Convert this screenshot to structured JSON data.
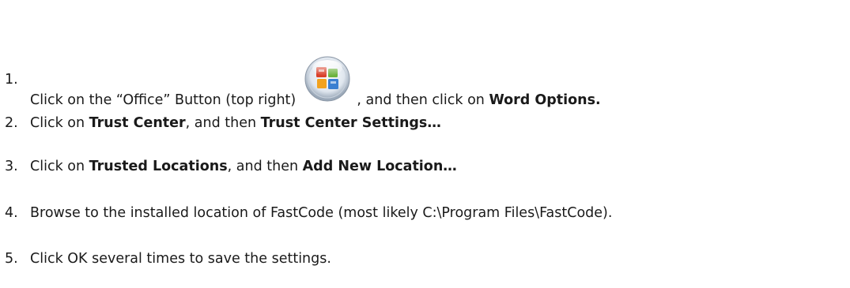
{
  "steps": [
    {
      "num": "1.",
      "before_icon": "Click on the “Office” Button (top right)",
      "icon": "office-button-icon",
      "after_icon": ", and then click on ",
      "bold": "Word Options."
    },
    {
      "num": "2.",
      "lead": "Click on ",
      "bold1": "Trust Center",
      "mid": ", and then ",
      "bold2": "Trust Center Settings…"
    },
    {
      "num": "3.",
      "lead": "Click on ",
      "bold1": "Trusted Locations",
      "mid": ", and then ",
      "bold2": "Add New Location…"
    },
    {
      "num": "4.",
      "text": "Browse to the installed location of FastCode (most likely C:\\Program Files\\FastCode)."
    },
    {
      "num": "5.",
      "text": "Click OK several times to save the settings."
    }
  ],
  "colors": {
    "text": "#1a1a1a",
    "office_red": "#d9412b",
    "office_green": "#6db33f",
    "office_blue": "#3a7fd1",
    "office_orange": "#f2a21e"
  }
}
